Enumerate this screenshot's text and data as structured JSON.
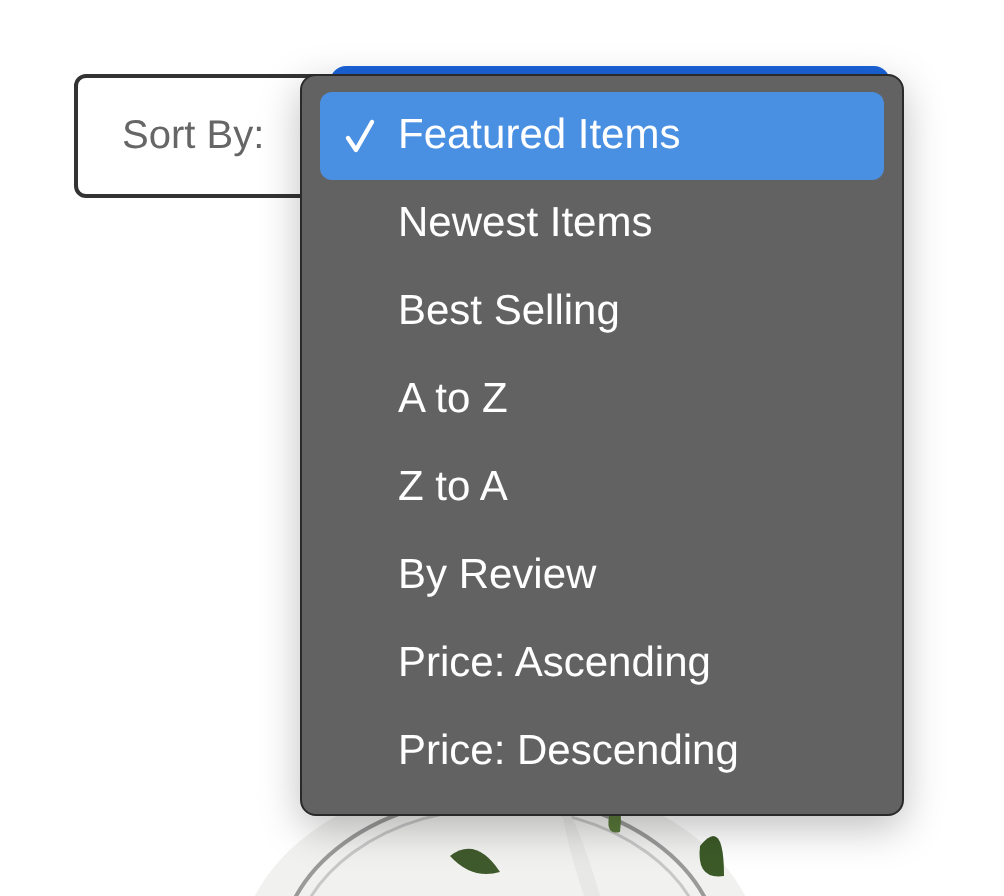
{
  "sort": {
    "label": "Sort By:"
  },
  "options": [
    {
      "label": "Featured Items",
      "selected": true
    },
    {
      "label": "Newest Items",
      "selected": false
    },
    {
      "label": "Best Selling",
      "selected": false
    },
    {
      "label": "A to Z",
      "selected": false
    },
    {
      "label": "Z to A",
      "selected": false
    },
    {
      "label": "By Review",
      "selected": false
    },
    {
      "label": "Price: Ascending",
      "selected": false
    },
    {
      "label": "Price: Descending",
      "selected": false
    }
  ]
}
